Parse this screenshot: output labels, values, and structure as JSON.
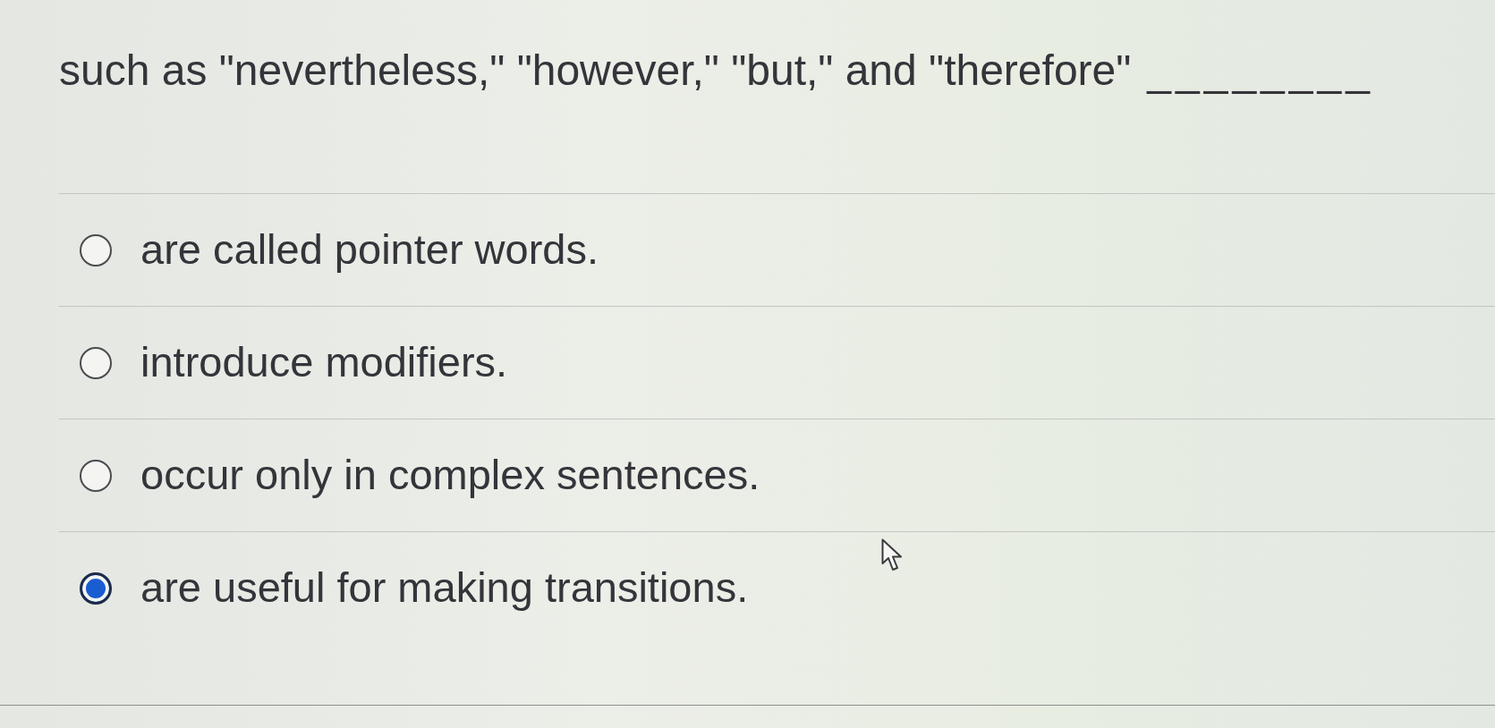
{
  "question": {
    "text": "such as \"nevertheless,\" \"however,\" \"but,\" and \"therefore\"",
    "blank": "________"
  },
  "options": [
    {
      "label": "are called pointer words.",
      "selected": false
    },
    {
      "label": "introduce modifiers.",
      "selected": false
    },
    {
      "label": "occur only in complex sentences.",
      "selected": false
    },
    {
      "label": "are useful for making transitions.",
      "selected": true
    }
  ]
}
